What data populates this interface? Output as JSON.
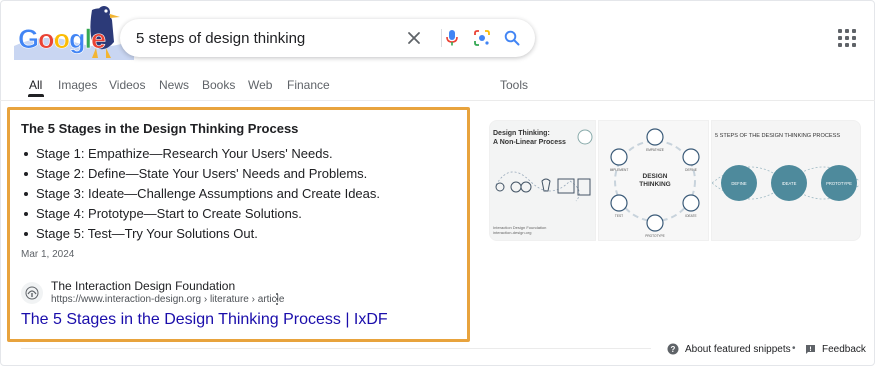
{
  "logo": {
    "text": "Google"
  },
  "search": {
    "query": "5 steps of design thinking"
  },
  "tabs": [
    {
      "label": "All"
    },
    {
      "label": "Images"
    },
    {
      "label": "Videos"
    },
    {
      "label": "News"
    },
    {
      "label": "Books"
    },
    {
      "label": "Web"
    },
    {
      "label": "Finance"
    }
  ],
  "tools_label": "Tools",
  "snippet": {
    "title": "The 5 Stages in the Design Thinking Process",
    "items": [
      "Stage 1: Empathize—Research Your Users' Needs.",
      "Stage 2: Define—State Your Users' Needs and Problems.",
      "Stage 3: Ideate—Challenge Assumptions and Create Ideas.",
      "Stage 4: Prototype—Start to Create Solutions.",
      "Stage 5: Test—Try Your Solutions Out."
    ],
    "date": "Mar 1, 2024",
    "source_name": "The Interaction Design Foundation",
    "source_url": "https://www.interaction-design.org › literature › article",
    "link_text": "The 5 Stages in the Design Thinking Process | IxDF"
  },
  "images": {
    "img1": {
      "title_line1": "Design Thinking:",
      "title_line2": "A Non-Linear Process",
      "caption1": "Interaction Design Foundation",
      "caption2": "interaction-design.org"
    },
    "img2": {
      "center_line1": "DESIGN",
      "center_line2": "THINKING",
      "labels": [
        "EMPATHIZE",
        "DEFINE",
        "IDEATE",
        "PROTOTYPE",
        "TEST",
        "IMPLEMENT"
      ]
    },
    "img3": {
      "title": "5 STEPS OF THE DESIGN THINKING PROCESS",
      "circles": [
        "DEFINE",
        "IDEATE",
        "PROTOTYPE"
      ]
    }
  },
  "footer": {
    "about_label": "About featured snippets",
    "separator": "•",
    "feedback_label": "Feedback"
  },
  "colors": {
    "highlight_border": "#e8a33d",
    "link": "#1a0dab",
    "teal_circle": "#4e8a9c"
  }
}
